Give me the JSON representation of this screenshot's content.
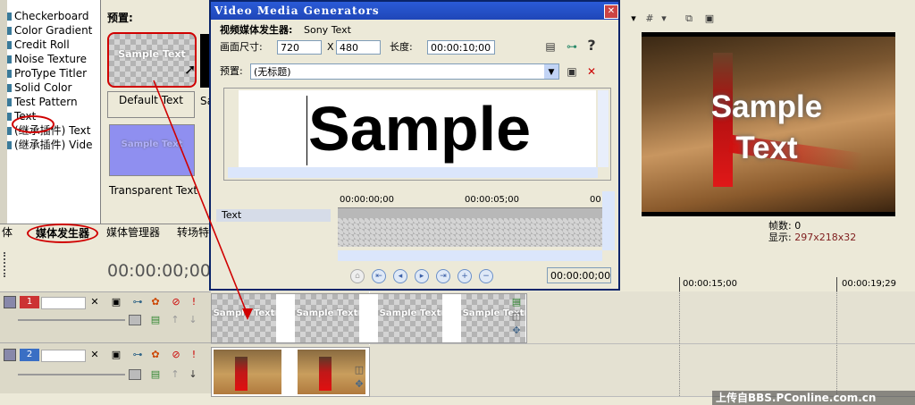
{
  "generators": {
    "items": [
      "Checkerboard",
      "Color Gradient",
      "Credit Roll",
      "Noise Texture",
      "ProType Titler",
      "Solid Color",
      "Test Pattern",
      "Text",
      "(继承插件) Text",
      "(继承插件) Vide"
    ],
    "presets_label": "预置:",
    "preset_thumb_text": "Sample Text",
    "preset_default_label": "Default Text",
    "preset_transparent_label": "Transparent Text",
    "preset_cut_label": "Sa"
  },
  "tabs": {
    "cut_left": "体",
    "media_generators": "媒体发生器",
    "media_manager": "媒体管理器",
    "transitions": "转场特"
  },
  "timeline": {
    "timecode": "00:00:00;00",
    "ruler": [
      "00:00:15;00",
      "00:00:19;29"
    ],
    "track1_number": "1",
    "track2_number": "2",
    "clip_text": "Sample Text"
  },
  "dialog": {
    "title": "Video Media Generators",
    "generator_label": "视频媒体发生器:",
    "generator_value": "Sony Text",
    "frame_size_label": "画面尺寸:",
    "width": "720",
    "x": "X",
    "height": "480",
    "length_label": "长度:",
    "length": "00:00:10;00",
    "preset_label": "预置:",
    "preset_value": "(无标题)",
    "sample_text": "Sample",
    "keyframe_label": "Text",
    "ruler": [
      "00:00:00;00",
      "00:00:05;00",
      "00"
    ],
    "current_time": "00:00:00;00"
  },
  "preview": {
    "overlay_line1": "Sample",
    "overlay_line2": "Text",
    "frames_label": "帧数:",
    "frames_value": "0",
    "display_label": "显示:",
    "display_value": "297x218x32"
  },
  "watermark": "上传自BBS.PConline.com.cn",
  "colors": {
    "accent_red": "#d00000",
    "title_blue": "#1f46b8"
  }
}
